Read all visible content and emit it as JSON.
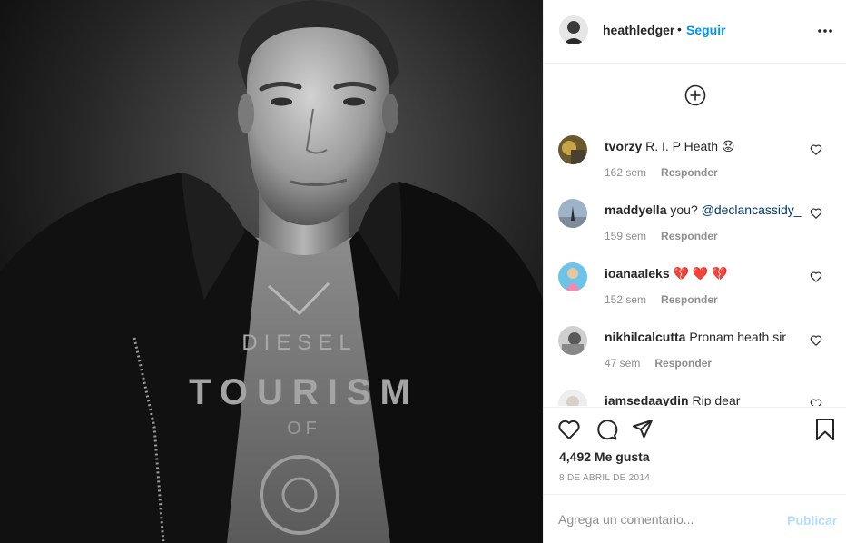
{
  "post": {
    "image_alt": "Black and white portrait photo",
    "shirt_text": [
      "DIESEL",
      "TOURISM",
      "OF"
    ]
  },
  "header": {
    "username": "heathledger",
    "separator": "•",
    "follow_label": "Seguir",
    "more_icon": "more-horizontal-icon"
  },
  "comments": {
    "load_more_icon": "plus-circle-icon",
    "items": [
      {
        "user": "tvorzy",
        "text": "R. I. P Heath",
        "emoji": "😟",
        "time": "162 sem",
        "reply": "Responder"
      },
      {
        "user": "maddyella",
        "text": "you?",
        "mention": "@declancassidy_",
        "time": "159 sem",
        "reply": "Responder"
      },
      {
        "user": "ioanaaleks",
        "text": "💔 ❤️ 💔",
        "time": "152 sem",
        "reply": "Responder"
      },
      {
        "user": "nikhilcalcutta",
        "text": "Pronam heath sir",
        "time": "47 sem",
        "reply": "Responder"
      },
      {
        "user": "iamsedaaydin",
        "text": "Rip dear",
        "time": "",
        "reply": ""
      }
    ]
  },
  "actions": {
    "icons": [
      "heart-icon",
      "comment-icon",
      "share-icon",
      "bookmark-icon"
    ],
    "likes": "4,492 Me gusta",
    "date": "8 DE ABRIL DE 2014"
  },
  "composer": {
    "placeholder": "Agrega un comentario...",
    "publish_label": "Publicar"
  },
  "colors": {
    "accent": "#0095f6",
    "publish_disabled": "#b2dffc",
    "text": "#262626",
    "muted": "#8e8e8e",
    "mention": "#00376b"
  }
}
